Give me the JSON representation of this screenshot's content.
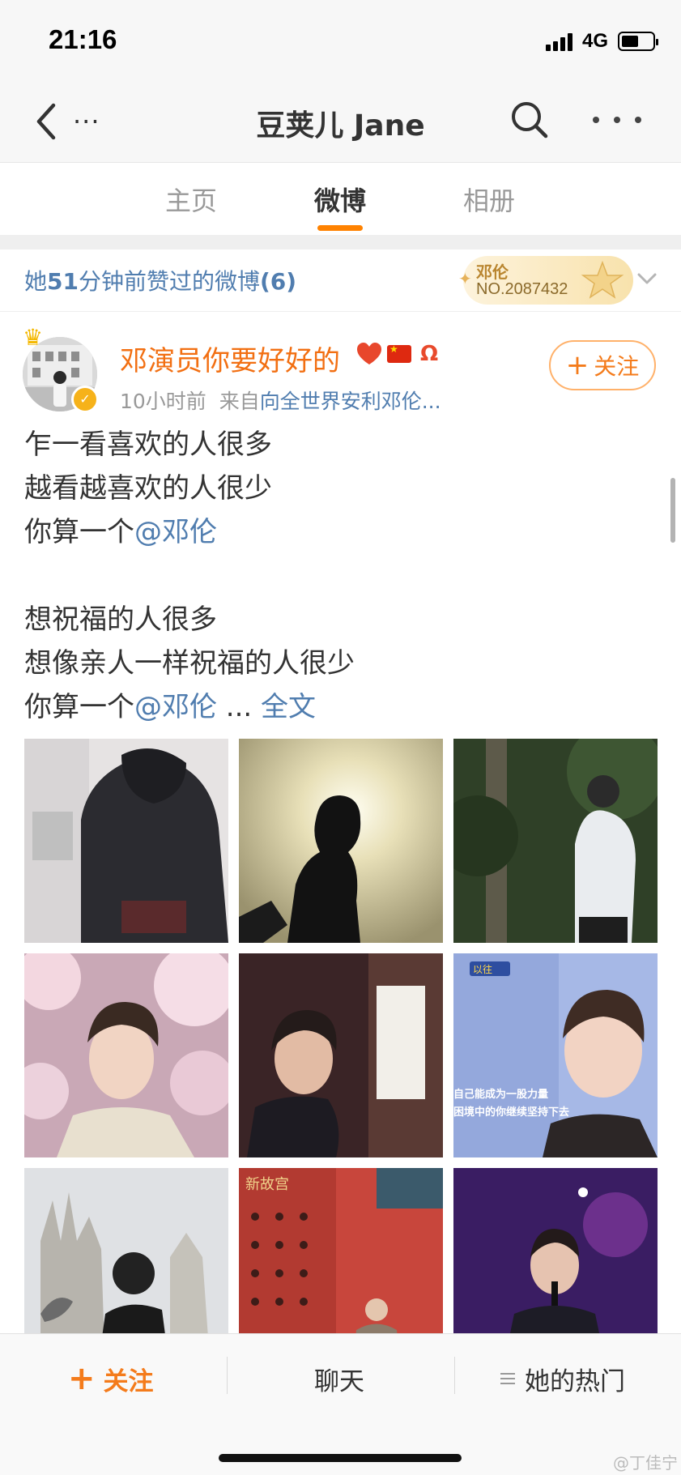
{
  "status_bar": {
    "time": "21:16",
    "network": "4G",
    "battery_level": 0.55
  },
  "nav": {
    "title": "豆荚儿 Jane",
    "back_extra": "..."
  },
  "tabs": [
    {
      "label": "主页",
      "active": false
    },
    {
      "label": "微博",
      "active": true
    },
    {
      "label": "相册",
      "active": false
    }
  ],
  "liked_header": {
    "prefix": "她",
    "minutes": "51",
    "middle": "分钟前赞过的微博",
    "count": "(6)",
    "fan_badge_name": "邓伦",
    "fan_badge_number": "NO.2087432"
  },
  "post": {
    "username": "邓演员你要好好的",
    "time": "10小时前",
    "source_prefix": "来自",
    "source": "向全世界安利邓伦...",
    "follow_label": "关注",
    "lines": [
      {
        "text": "乍一看喜欢的人很多"
      },
      {
        "text": "越看越喜欢的人很少"
      },
      {
        "text": "你算一个",
        "mention": "@邓伦"
      },
      {
        "text": ""
      },
      {
        "text": "想祝福的人很多"
      },
      {
        "text": "想像亲人一样祝福的人很少"
      },
      {
        "text": "你算一个",
        "mention": "@邓伦",
        "ellipsis": " ... ",
        "more": "全文"
      }
    ],
    "photos": [
      {
        "desc": "person-in-black-hoodie"
      },
      {
        "desc": "silhouette-against-sun"
      },
      {
        "desc": "person-in-forest"
      },
      {
        "desc": "portrait-cherry-blossoms"
      },
      {
        "desc": "portrait-by-window"
      },
      {
        "desc": "tv-show-screenshot",
        "captions": [
          "自己能成为一股力量",
          "困境中的你继续坚持下去"
        ],
        "tag": "以往"
      },
      {
        "desc": "milan-cathedral-with-pigeons"
      },
      {
        "desc": "forbidden-city-red-door",
        "tag": "新故宫"
      },
      {
        "desc": "singing-on-stage"
      }
    ]
  },
  "bottom_bar": {
    "follow": "关注",
    "chat": "聊天",
    "hot": "她的热门"
  },
  "watermark": "@丁佳宁",
  "colors": {
    "accent": "#ff8200",
    "link": "#507daf",
    "username": "#f26f12"
  }
}
